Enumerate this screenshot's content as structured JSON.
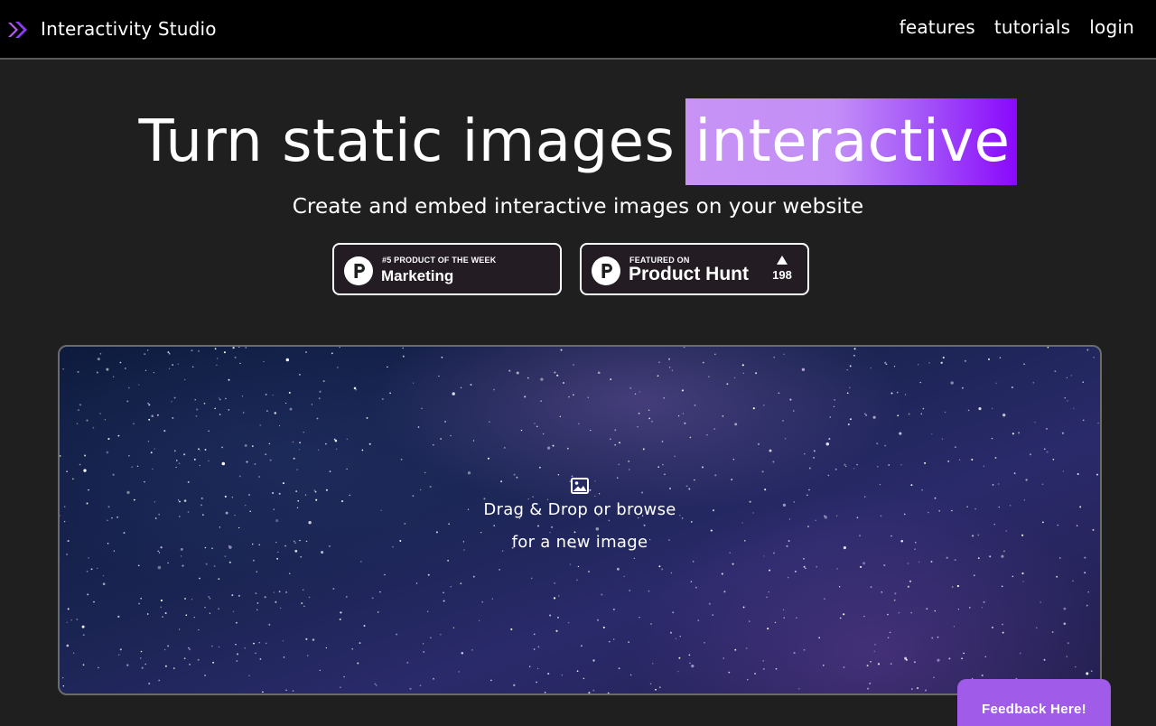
{
  "header": {
    "brand": "Interactivity Studio",
    "logo_icon": "double-chevron-icon",
    "nav": {
      "features": "features",
      "tutorials": "tutorials",
      "login": "login"
    }
  },
  "hero": {
    "title_static": "Turn static images",
    "title_highlight": "interactive",
    "subtitle": "Create and embed interactive images on your website"
  },
  "badges": {
    "first": {
      "small_text": "#5 PRODUCT OF THE WEEK",
      "big_text": "Marketing",
      "icon": "product-hunt-icon"
    },
    "second": {
      "small_text": "FEATURED ON",
      "big_text": "Product Hunt",
      "upvote_count": "198",
      "icon": "product-hunt-icon"
    }
  },
  "dropzone": {
    "icon": "image-icon",
    "line1": "Drag & Drop or browse",
    "line2": "for a new image"
  },
  "feedback": {
    "label": "Feedback Here!"
  },
  "colors": {
    "accent_purple": "#8a08fc",
    "highlight_light": "#c893f5",
    "feedback_button": "#a05ce8",
    "background": "#1f1f1f"
  }
}
